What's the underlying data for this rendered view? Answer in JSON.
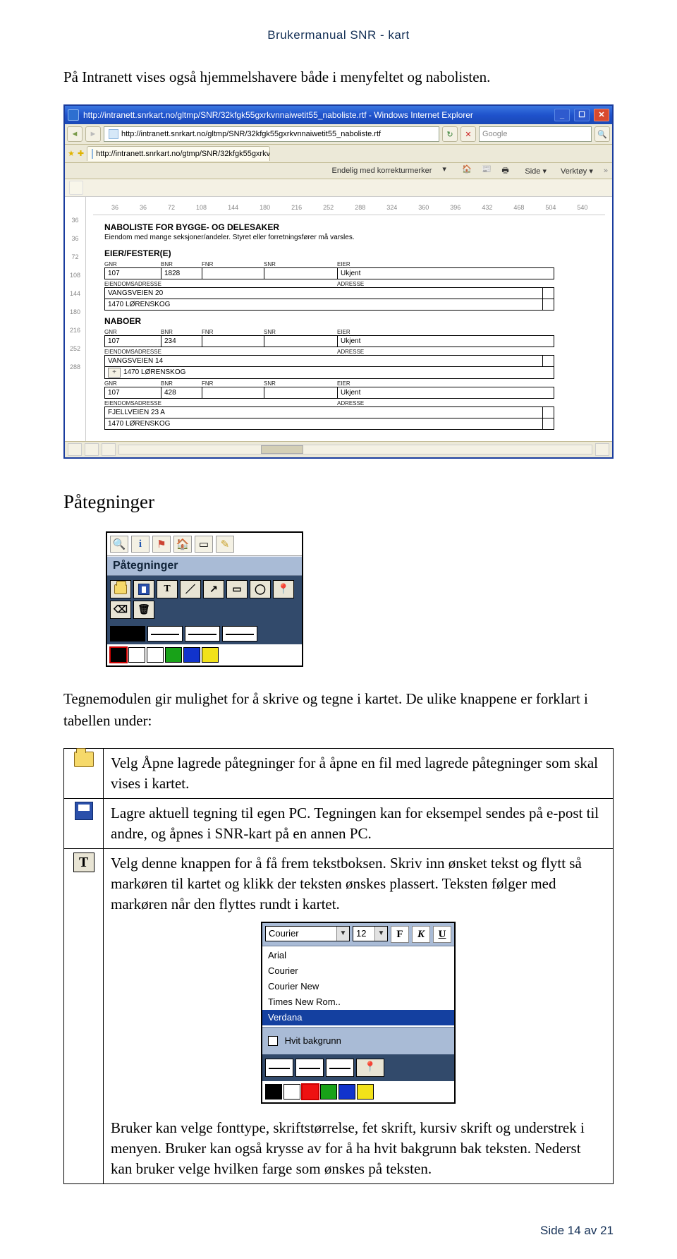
{
  "docHeader": "Brukermanual SNR - kart",
  "introPara": "På Intranett vises også hjemmelshavere både i menyfeltet og nabolisten.",
  "screenshot": {
    "windowTitle": "http://intranett.snrkart.no/gltmp/SNR/32kfgk55gxrkvnnaiwetit55_naboliste.rtf - Windows Internet Explorer",
    "urlText": "http://intranett.snrkart.no/gltmp/SNR/32kfgk55gxrkvnnaiwetit55_naboliste.rtf",
    "searchProvider": "Google",
    "tabLabel": "http://intranett.snrkart.no/gtmp/SNR/32kfgk55gxrkv...",
    "menu": {
      "korrektur": "Endelig med korrekturmerker",
      "side": "Side",
      "verktoy": "Verktøy"
    },
    "hrulerMarks": [
      "36",
      "36",
      "72",
      "108",
      "144",
      "180",
      "216",
      "252",
      "288",
      "324",
      "360",
      "396",
      "432",
      "468",
      "504",
      "540"
    ],
    "vrulerMarks": [
      "36",
      "36",
      "72",
      "108",
      "144",
      "180",
      "216",
      "252",
      "288"
    ],
    "docTitle": "NABOLISTE FOR BYGGE- OG DELESAKER",
    "docSub": "Eiendom med mange seksjoner/andeler. Styret eller forretningsfører må varsles.",
    "eierHdr": "EIER/FESTER(E)",
    "miniHdr": {
      "gnr": "GNR",
      "bnr": "BNR",
      "fnr": "FNR",
      "snr": "SNR",
      "eier": "EIER"
    },
    "addrLbl": "EIENDOMSADRESSE",
    "addrLbl2": "ADRESSE",
    "rowA": {
      "gnr": "107",
      "bnr": "1828",
      "eier": "Ukjent"
    },
    "rowAaddr1": "VANGSVEIEN 20",
    "rowAaddr2": "1470 LØRENSKOG",
    "naboHdr": "NABOER",
    "rowB": {
      "gnr": "107",
      "bnr": "234",
      "eier": "Ukjent"
    },
    "rowBaddr1": "VANGSVEIEN 14",
    "rowBaddr2": "1470 LØRENSKOG",
    "rowC": {
      "gnr": "107",
      "bnr": "428",
      "eier": "Ukjent"
    },
    "rowCaddr1": "FJELLVEIEN 23 A",
    "rowCaddr2": "1470 LØRENSKOG"
  },
  "h2": "Påtegninger",
  "panelLabel": "Påtegninger",
  "tbT": "T",
  "explainIntro": "Tegnemodulen gir mulighet for å skrive og tegne i kartet. De ulike knappene er forklart i tabellen under:",
  "tblOpen": "Velg Åpne lagrede påtegninger for å åpne en fil med lagrede påtegninger som skal vises i kartet.",
  "tblSave": "Lagre aktuell tegning til egen PC. Tegningen kan for eksempel sendes på e-post til andre, og åpnes i SNR-kart på en annen PC.",
  "tblTextA": "Velg denne knappen for å få frem tekstboksen. Skriv inn ønsket tekst og flytt så markøren til kartet og klikk der teksten ønskes plassert. Teksten følger med markøren når den flyttes rundt i kartet.",
  "fontPanel": {
    "fontSel": "Courier",
    "sizeSel": "12",
    "fonts": [
      "Arial",
      "Courier",
      "Courier New",
      "Times New Rom..",
      "Verdana"
    ],
    "checkbox": "Hvit bakgrunn",
    "btnF": "F",
    "btnK": "K",
    "btnU": "U"
  },
  "tblTextB": "Bruker kan velge fonttype, skriftstørrelse, fet skrift, kursiv skrift og understrek i menyen. Bruker kan også krysse av for å ha hvit bakgrunn bak teksten. Nederst kan bruker velge hvilken farge som ønskes på teksten.",
  "footer": "Side 14 av 21",
  "colors": {
    "black": "#000",
    "white": "#fff",
    "red": "#e11",
    "green": "#18a218",
    "blue": "#1133cc",
    "yellow": "#f2e21a"
  }
}
